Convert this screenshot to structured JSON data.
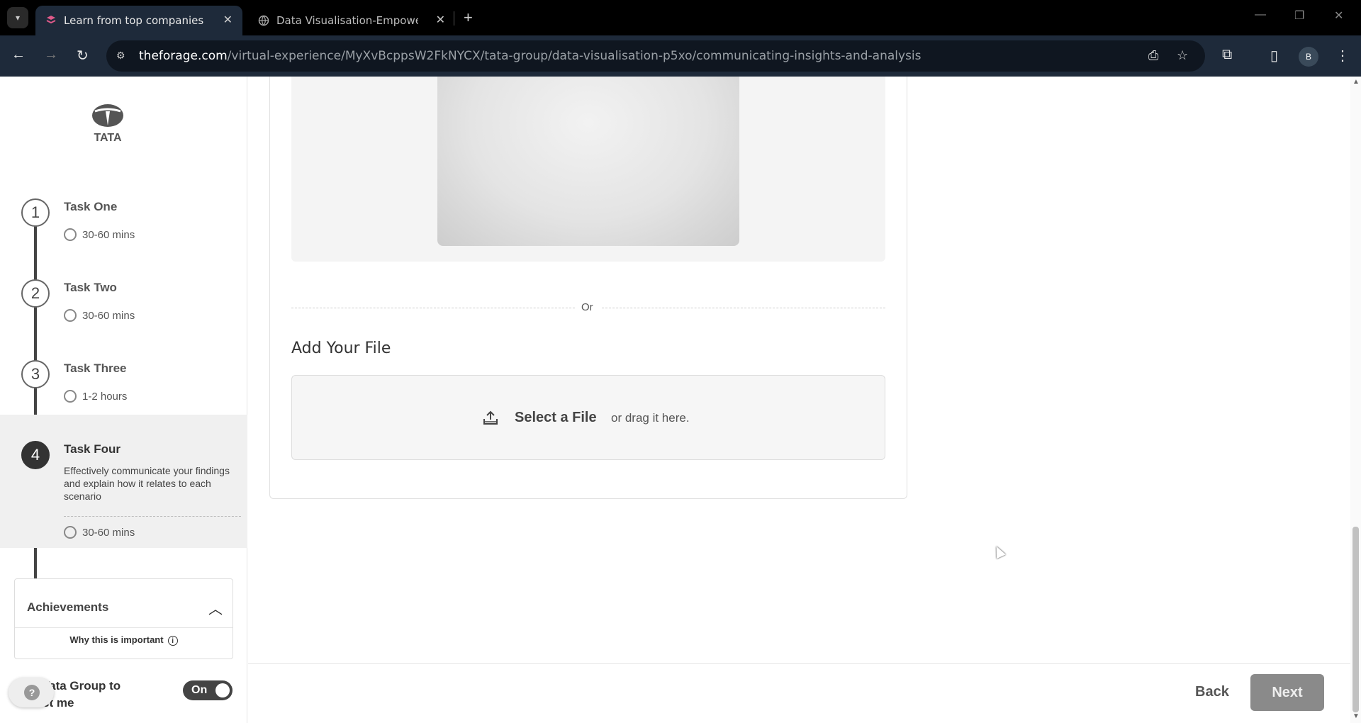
{
  "browser": {
    "tabs": [
      {
        "title": "Learn from top companies and",
        "active": true
      },
      {
        "title": "Data Visualisation-Empowering",
        "active": false
      }
    ],
    "url_host": "theforage.com",
    "url_path": "/virtual-experience/MyXvBcppsW2FkNYCX/tata-group/data-visualisation-p5xo/communicating-insights-and-analysis",
    "profile_initial": "B"
  },
  "sidebar": {
    "steps": [
      {
        "num": "1",
        "title": "Task One",
        "time": "30-60 mins"
      },
      {
        "num": "2",
        "title": "Task Two",
        "time": "30-60 mins"
      },
      {
        "num": "3",
        "title": "Task Three",
        "time": "1-2 hours"
      },
      {
        "num": "4",
        "title": "Task Four",
        "desc": "Effectively communicate your findings and explain how it relates to each scenario",
        "time": "30-60 mins"
      }
    ],
    "achievements": {
      "title": "Achievements",
      "why": "Why this is important"
    },
    "contact_label_line1": "Tata Group to",
    "contact_label_line2": "ct me",
    "toggle_label": "On"
  },
  "main": {
    "or_text": "Or",
    "add_title": "Add Your File",
    "select_file": "Select a File",
    "drag_text": "or drag it here."
  },
  "footer": {
    "back": "Back",
    "next": "Next"
  }
}
